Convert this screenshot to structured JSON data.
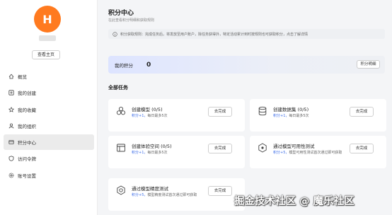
{
  "profile": {
    "avatar_letter": "H",
    "home_button": "查看主页"
  },
  "sidebar": {
    "items": [
      {
        "label": "概览",
        "icon": "overview-icon"
      },
      {
        "label": "我的创建",
        "icon": "create-icon"
      },
      {
        "label": "我的收藏",
        "icon": "favorite-icon"
      },
      {
        "label": "我的组织",
        "icon": "organization-icon"
      },
      {
        "label": "积分中心",
        "icon": "points-icon",
        "active": true
      },
      {
        "label": "访问令牌",
        "icon": "token-icon"
      },
      {
        "label": "账号设置",
        "icon": "settings-icon"
      }
    ]
  },
  "page": {
    "title": "积分中心",
    "subtitle": "在此查看积分明细和获取规则"
  },
  "notice": "积分获取规则：完成任务后，将发放至用户账户，除任务获得外，特定活动累计到时按规则也可获取积分，点击了解详情",
  "my_points": {
    "label": "我的积分",
    "value": "0",
    "detail_button": "积分明细"
  },
  "section_title": "全部任务",
  "tasks": [
    {
      "title": "创建模型 (0/5)",
      "points": "积分+1，",
      "desc": "每日最多5次",
      "button": "去完成",
      "icon": "model-icon"
    },
    {
      "title": "创建数据集 (0/5)",
      "points": "积分+1，",
      "desc": "每日最多5次",
      "button": "去完成",
      "icon": "dataset-icon"
    },
    {
      "title": "创建体验空间 (0/5)",
      "points": "积分+1，",
      "desc": "每日最多5次",
      "button": "去完成",
      "icon": "space-icon"
    },
    {
      "title": "通过模型可用性测试",
      "points": "积分+5，",
      "desc": "模型可用性测试首次通过即可获取",
      "button": "去完成",
      "icon": "availability-test-icon"
    },
    {
      "title": "通过模型精度测试",
      "points": "积分+5，",
      "desc": "模型精度测试首次通过即可获取",
      "button": "去完成",
      "icon": "accuracy-test-icon"
    }
  ],
  "watermark": "掘金技术社区 @ 魔乐社区",
  "colors": {
    "accent": "#3f6fe8",
    "avatar": "#ff7a1f"
  }
}
